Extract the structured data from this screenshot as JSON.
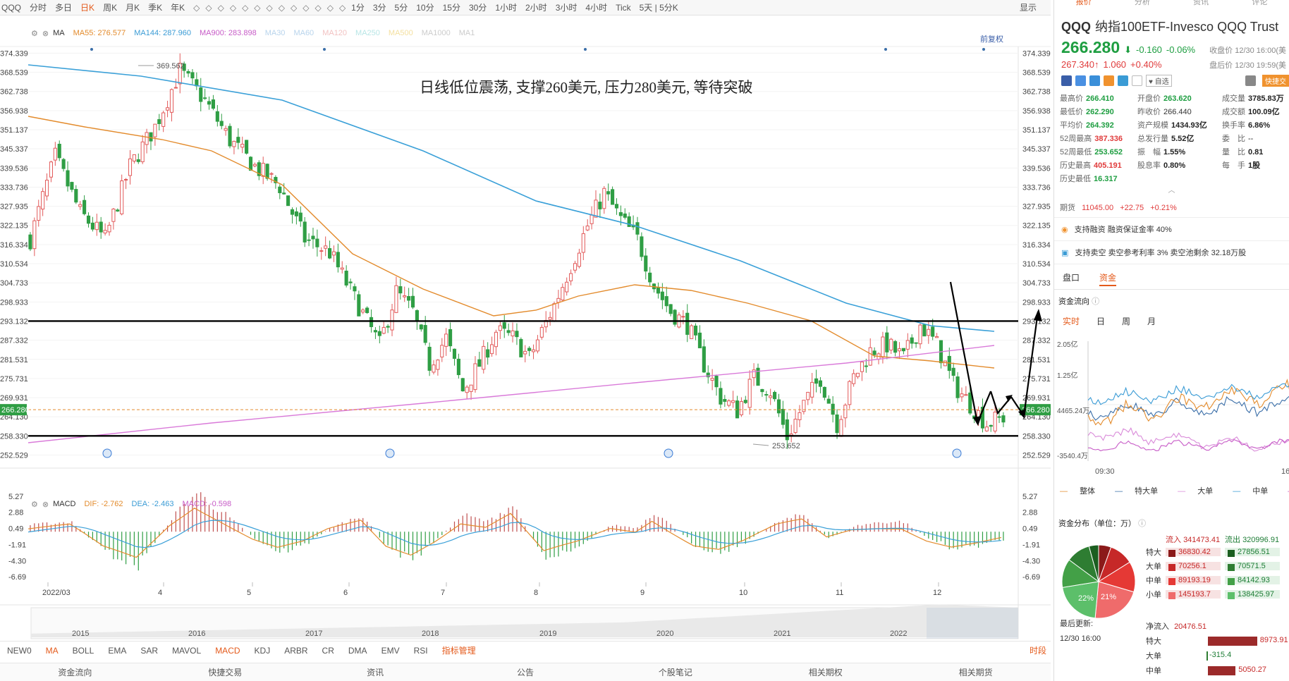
{
  "toolbar": {
    "items": [
      "QQQ",
      "分时",
      "多日",
      "日K",
      "周K",
      "月K",
      "季K",
      "年K",
      "1分",
      "3分",
      "5分",
      "10分",
      "15分",
      "30分",
      "1小时",
      "2小时",
      "3小时",
      "4小时",
      "Tick",
      "5天 | 5分K"
    ],
    "active_index": 3,
    "right_label": "显示"
  },
  "ma_row": {
    "label": "MA",
    "items": [
      {
        "text": "MA55: 276.577",
        "color": "#e38b2c"
      },
      {
        "text": "MA144: 287.960",
        "color": "#3a9bd5"
      },
      {
        "text": "MA900: 283.898",
        "color": "#c75bc7"
      },
      {
        "text": "MA30",
        "color": "#b8d4ec"
      },
      {
        "text": "MA60",
        "color": "#b8d4ec"
      },
      {
        "text": "MA120",
        "color": "#f2c2c2"
      },
      {
        "text": "MA250",
        "color": "#b8e6e6"
      },
      {
        "text": "MA500",
        "color": "#f4e0a0"
      },
      {
        "text": "MA1000",
        "color": "#cccccc"
      },
      {
        "text": "MA1",
        "color": "#cccccc"
      }
    ],
    "adjust_label": "前复权"
  },
  "macd_row": {
    "label": "MACD",
    "items": [
      {
        "text": "DIF: -2.762",
        "color": "#e38b2c"
      },
      {
        "text": "DEA: -2.463",
        "color": "#3a9bd5"
      },
      {
        "text": "MACD: -0.598",
        "color": "#c75bc7"
      }
    ]
  },
  "annotation": "日线低位震荡, 支撑260美元, 压力280美元, 等待突破",
  "price_axis": [
    "374.339",
    "368.539",
    "362.738",
    "356.938",
    "351.137",
    "345.337",
    "339.536",
    "333.736",
    "327.935",
    "322.135",
    "316.334",
    "310.534",
    "304.733",
    "298.933",
    "293.132",
    "287.332",
    "281.531",
    "275.731",
    "269.931",
    "264.130",
    "258.330",
    "252.529"
  ],
  "current_price_tag": "266.280",
  "high_label": "369.562",
  "low_label": "253.652",
  "macd_axis": [
    "5.27",
    "2.88",
    "0.49",
    "-1.91",
    "-4.30",
    "-6.69"
  ],
  "month_labels": [
    "2022/03",
    "4",
    "5",
    "6",
    "7",
    "8",
    "9",
    "10",
    "11",
    "12"
  ],
  "year_labels": [
    "2015",
    "2016",
    "2017",
    "2018",
    "2019",
    "2020",
    "2021",
    "2022"
  ],
  "indicator_tabs": [
    "NEW0",
    "MA",
    "BOLL",
    "EMA",
    "SAR",
    "MAVOL",
    "MACD",
    "KDJ",
    "ARBR",
    "CR",
    "DMA",
    "EMV",
    "RSI"
  ],
  "indicator_manager": "指标管理",
  "timing_label": "时段",
  "bottom_tabs": [
    "资金流向",
    "快捷交易",
    "资讯",
    "公告",
    "个股笔记",
    "相关期权",
    "相关期货"
  ],
  "right": {
    "tabs": [
      "报价",
      "分析",
      "资讯",
      "评论"
    ],
    "ticker": "QQQ",
    "name": "纳指100ETF-Invesco QQQ Trust",
    "price": "266.280",
    "change": "-0.160",
    "change_pct": "-0.06%",
    "close_time": "收盘价 12/30 16:00(美",
    "after_price": "267.340",
    "after_change": "1.060",
    "after_pct": "+0.40%",
    "after_time": "盘后价 12/30 19:59(美",
    "zixuan": "自选",
    "kuaijie": "快捷交",
    "stats": [
      [
        {
          "l": "最高价",
          "v": "266.410",
          "c": "g"
        },
        {
          "l": "开盘价",
          "v": "263.620",
          "c": "g"
        },
        {
          "l": "成交量",
          "v": "3785.83万",
          "c": "k"
        }
      ],
      [
        {
          "l": "最低价",
          "v": "262.290",
          "c": "g"
        },
        {
          "l": "昨收价",
          "v": "266.440",
          "c": "n"
        },
        {
          "l": "成交额",
          "v": "100.09亿",
          "c": "k"
        }
      ],
      [
        {
          "l": "平均价",
          "v": "264.392",
          "c": "g"
        },
        {
          "l": "资产规模",
          "v": "1434.93亿",
          "c": "k"
        },
        {
          "l": "换手率",
          "v": "6.86%",
          "c": "k"
        }
      ],
      [
        {
          "l": "52周最高",
          "v": "387.336",
          "c": "v"
        },
        {
          "l": "总发行量",
          "v": "5.52亿",
          "c": "k"
        },
        {
          "l": "委　比",
          "v": "--",
          "c": "n"
        }
      ],
      [
        {
          "l": "52周最低",
          "v": "253.652",
          "c": "g"
        },
        {
          "l": "振　幅",
          "v": "1.55%",
          "c": "k"
        },
        {
          "l": "量　比",
          "v": "0.81",
          "c": "k"
        }
      ],
      [
        {
          "l": "历史最高",
          "v": "405.191",
          "c": "v"
        },
        {
          "l": "股息率",
          "v": "0.80%",
          "c": "k"
        },
        {
          "l": "每　手",
          "v": "1股",
          "c": "k"
        }
      ],
      [
        {
          "l": "历史最低",
          "v": "16.317",
          "c": "g"
        },
        {
          "l": "",
          "v": "",
          "c": "n"
        },
        {
          "l": "",
          "v": "",
          "c": "n"
        }
      ]
    ],
    "futures_label": "期货",
    "futures_value": "11045.00",
    "futures_change": "+22.75",
    "futures_pct": "+0.21%",
    "note1": "支持融资  融资保证金率 40%",
    "note2": "支持卖空  卖空参考利率 3%  卖空池剩余 32.18万股",
    "tabs2": [
      "盘口",
      "资金"
    ],
    "flow_title": "资金流向",
    "tabs3": [
      "实时",
      "日",
      "周",
      "月"
    ],
    "flow_axis": [
      "2.05亿",
      "1.25亿",
      "4465.24万",
      "-3540.4万"
    ],
    "flow_time_start": "09:30",
    "flow_time_end": "16",
    "flow_legend": [
      {
        "text": "整体",
        "color": "#e38b2c"
      },
      {
        "text": "特大单",
        "color": "#3a6ea8"
      },
      {
        "text": "大单",
        "color": "#d98ad9"
      },
      {
        "text": "中单",
        "color": "#3a9bd5"
      },
      {
        "text": "小单",
        "color": "#c75bc7"
      }
    ],
    "dist_title": "资金分布（单位：万）",
    "dist_in_label": "流入",
    "dist_in_total": "341473.41",
    "dist_out_label": "流出",
    "dist_out_total": "320996.91",
    "dist_rows": [
      {
        "label": "特大",
        "in": "36830.42",
        "out": "27856.51",
        "inc": "#8b1a1a",
        "outc": "#1b5e20"
      },
      {
        "label": "大单",
        "in": "70256.1",
        "out": "70571.5",
        "inc": "#c62828",
        "outc": "#2e7d32"
      },
      {
        "label": "中单",
        "in": "89193.19",
        "out": "84142.93",
        "inc": "#e53935",
        "outc": "#43a047"
      },
      {
        "label": "小单",
        "in": "145193.7",
        "out": "138425.97",
        "inc": "#ef6b6b",
        "outc": "#5cbf6a"
      }
    ],
    "pie_pct_left": "22%",
    "pie_pct_right": "21%",
    "update_label": "最后更新:",
    "update_time": "12/30 16:00",
    "net_label": "净流入",
    "net_total": "20476.51",
    "net_rows": [
      {
        "label": "特大",
        "value": "8973.91"
      },
      {
        "label": "大单",
        "value": "-315.4"
      },
      {
        "label": "中单",
        "value": "5050.27"
      }
    ]
  }
}
